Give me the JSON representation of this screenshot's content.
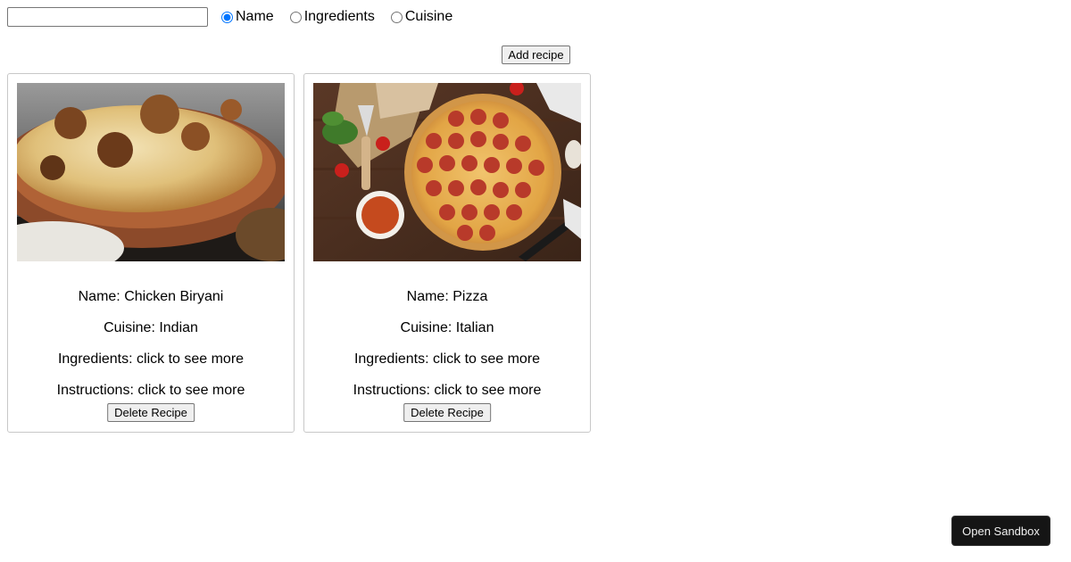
{
  "search": {
    "value": "",
    "placeholder": ""
  },
  "filter": {
    "selected": "Name",
    "options": [
      "Name",
      "Ingredients",
      "Cuisine"
    ]
  },
  "add_button_label": "Add recipe",
  "recipes": [
    {
      "image_desc": "Chicken biryani in clay pot",
      "name_line": "Name: Chicken Biryani",
      "cuisine_line": "Cuisine: Indian",
      "ingredients_line": "Ingredients: click to see more",
      "instructions_line": "Instructions: click to see more",
      "delete_label": "Delete Recipe"
    },
    {
      "image_desc": "Pepperoni pizza on wooden table",
      "name_line": "Name: Pizza",
      "cuisine_line": "Cuisine: Italian",
      "ingredients_line": "Ingredients: click to see more",
      "instructions_line": "Instructions: click to see more",
      "delete_label": "Delete Recipe"
    }
  ],
  "sandbox_button_label": "Open Sandbox",
  "colors": {
    "sandbox_bg": "#151515",
    "card_border": "#c8c8c8",
    "button_bg": "#efefef"
  }
}
